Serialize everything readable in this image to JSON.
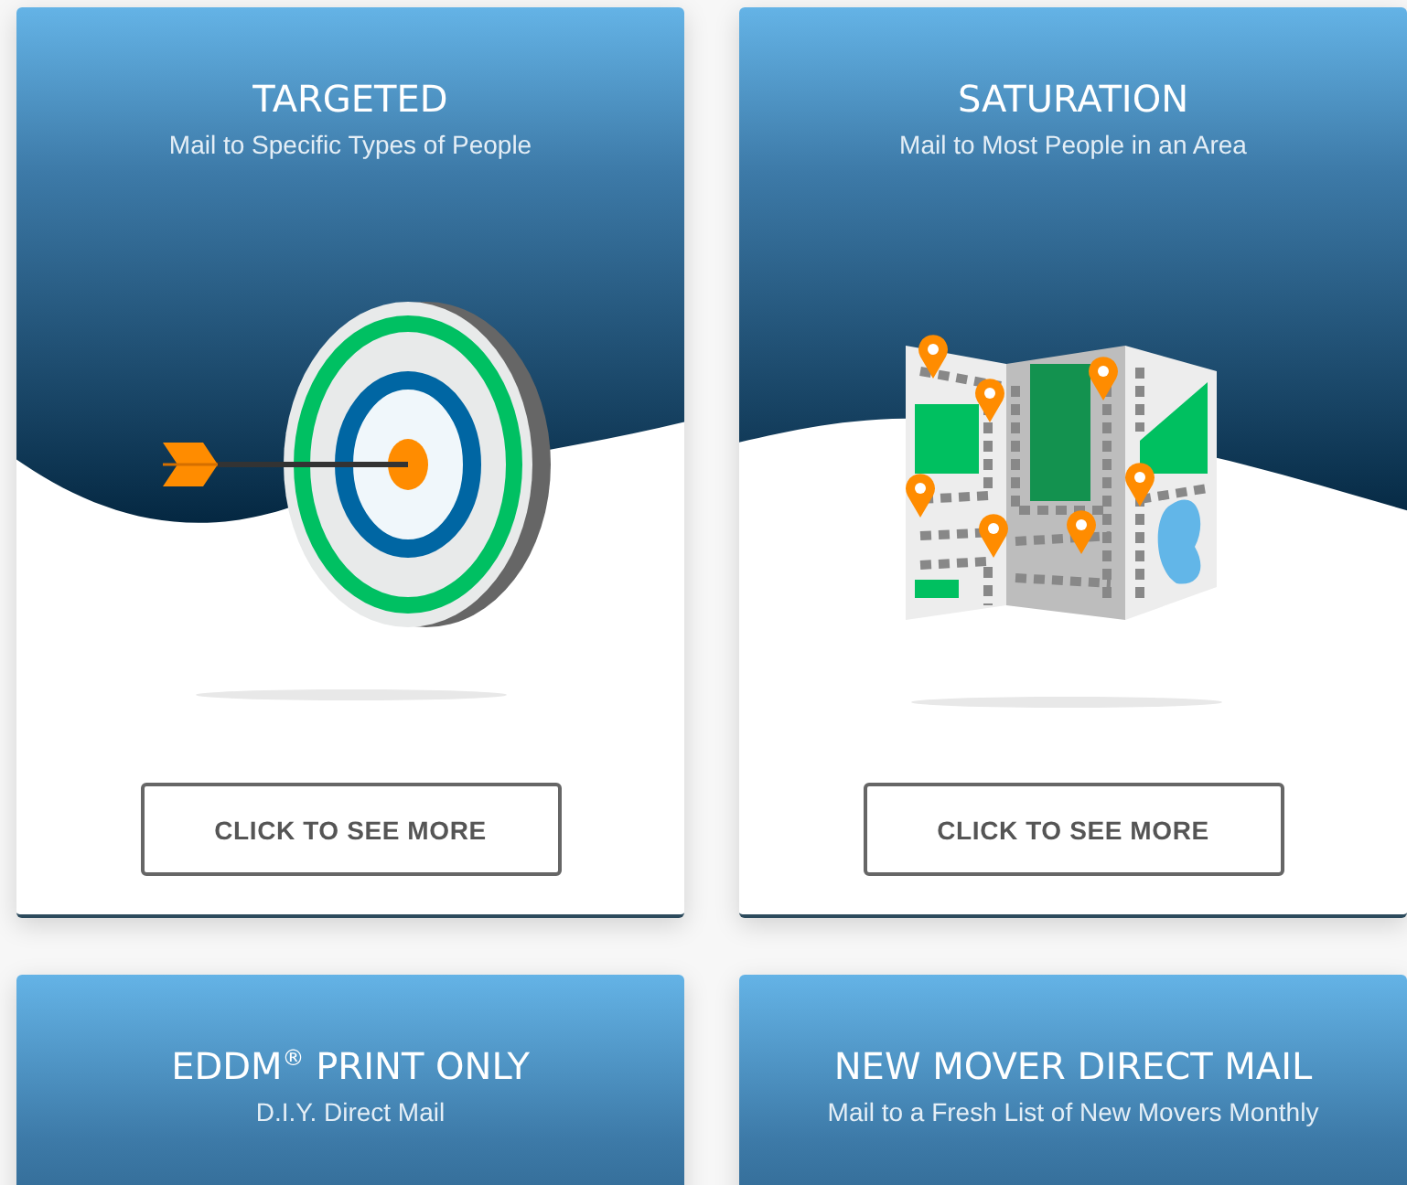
{
  "cards": [
    {
      "title": "TARGETED",
      "subtitle": "Mail to Specific Types of People",
      "kind": "target",
      "button": "CLICK TO SEE MORE"
    },
    {
      "title": "SATURATION",
      "subtitle": "Mail to Most People in an Area",
      "kind": "map",
      "button": "CLICK TO SEE MORE"
    },
    {
      "title": "EDDM$^{®}$ PRINT ONLY",
      "subtitle": "D.I.Y. Direct Mail"
    },
    {
      "title": "NEW MOVER DIRECT MAIL",
      "subtitle": "Mail to a Fresh List of New Movers Monthly"
    }
  ]
}
